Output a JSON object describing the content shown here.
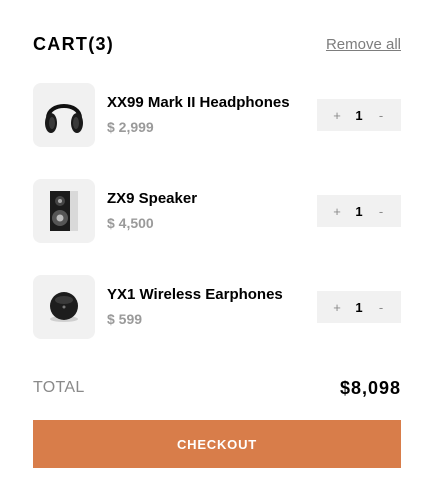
{
  "cart": {
    "title": "CART(3)",
    "remove_all_label": "Remove all",
    "items": [
      {
        "name": "XX99 Mark II Headphones",
        "price": "$ 2,999",
        "quantity": "1",
        "minus": "+",
        "plus": "-",
        "icon": "headphones-icon"
      },
      {
        "name": "ZX9 Speaker",
        "price": "$ 4,500",
        "quantity": "1",
        "minus": "+",
        "plus": "-",
        "icon": "speaker-icon"
      },
      {
        "name": "YX1 Wireless Earphones",
        "price": "$ 599",
        "quantity": "1",
        "minus": "+",
        "plus": "-",
        "icon": "earphones-icon"
      }
    ],
    "total_label": "TOTAL",
    "total_value": "$8,098",
    "checkout_label": "CHECKOUT"
  },
  "colors": {
    "accent": "#d87d4a",
    "thumb_bg": "#f1f1f1",
    "muted_text": "#9a9a9a"
  }
}
